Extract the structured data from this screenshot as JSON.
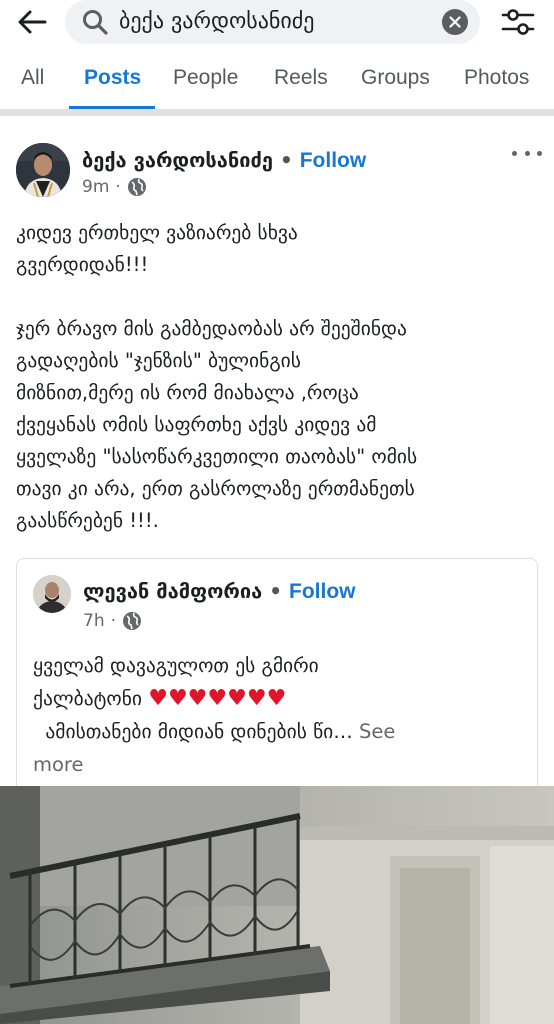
{
  "search": {
    "query": "ბექა ვარდოსანიძე",
    "icon": "search-icon",
    "clear_icon": "clear-icon",
    "back_icon": "back-arrow-icon",
    "filter_icon": "filter-sliders-icon"
  },
  "tabs": [
    {
      "label": "All",
      "active": false
    },
    {
      "label": "Posts",
      "active": true
    },
    {
      "label": "People",
      "active": false
    },
    {
      "label": "Reels",
      "active": false
    },
    {
      "label": "Groups",
      "active": false
    },
    {
      "label": "Photos",
      "active": false
    }
  ],
  "post": {
    "author": "ბექა ვარდოსანიძე",
    "separator": "•",
    "follow_label": "Follow",
    "time": "9m",
    "separator_meta": "·",
    "privacy_icon": "globe-icon",
    "more_icon": "more-options-icon",
    "text_lines": [
      "კიდევ ერთხელ ვაზიარებ სხვა",
      "გვერდიდან!!!",
      "",
      "ჯერ ბრავო მის გამბედაობას არ შეეშინდა",
      "გადაღების \"ჯენზის\" ბულინგის",
      "მიზნით,მერე ის რომ მიახალა ,როცა",
      "ქვეყანას ომის საფრთხე აქვს კიდევ ამ",
      "ყველაზე \"სასოწარკვეთილი თაობას\" ომის",
      "თავი კი არა, ერთ გასროლაზე ერთმანეთს",
      "გაასწრებენ !!!."
    ]
  },
  "shared_post": {
    "author": "ლევან მამფორია",
    "separator": "•",
    "follow_label": "Follow",
    "time": "7h",
    "separator_meta": "·",
    "privacy_icon": "globe-icon",
    "line1": "ყველამ დავაგულოთ ეს გმირი",
    "line2": "ქალბატონი",
    "hearts": "♥♥♥♥♥♥♥",
    "line3": "  ამისთანები მიდიან დინების წი…",
    "see_more": "See",
    "see_more_2": "more"
  },
  "colors": {
    "accent": "#1877d3",
    "text": "#1c1e21",
    "muted": "#65676b",
    "heart": "#e0142b",
    "divider": "#dfe1e5"
  }
}
